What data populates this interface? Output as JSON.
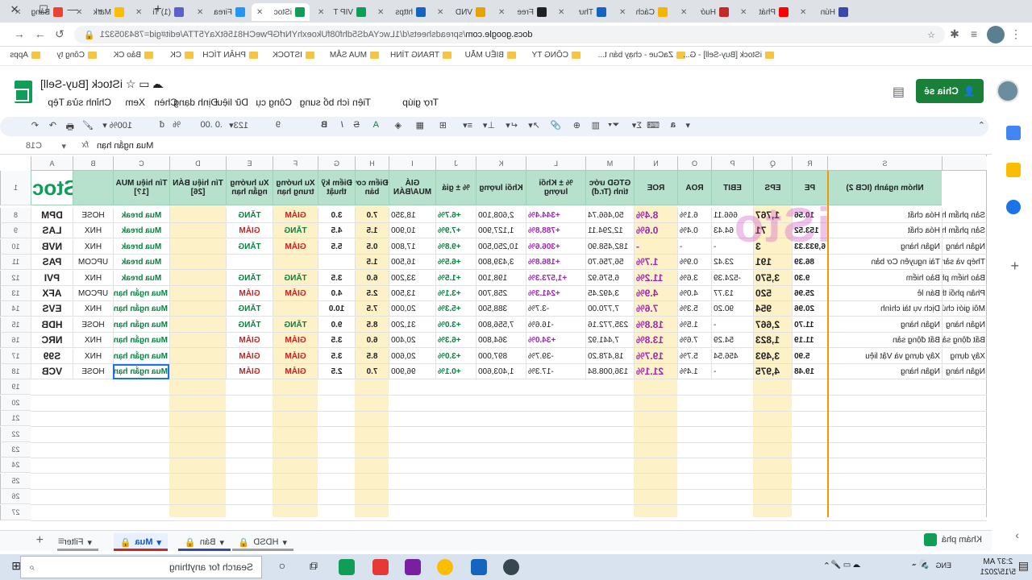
{
  "tabs": [
    {
      "title": "Bảng",
      "color": "#ea4335"
    },
    {
      "title": "Mark",
      "color": "#fbbc04"
    },
    {
      "title": "(1) Ti",
      "color": "#5b61c9"
    },
    {
      "title": "Firea",
      "color": "#2196f3"
    },
    {
      "title": "iStoc",
      "color": "#0f9d58",
      "active": true
    },
    {
      "title": "VIP T",
      "color": "#0f9d58"
    },
    {
      "title": "https",
      "color": "#1565c0"
    },
    {
      "title": "VND",
      "color": "#e6a400"
    },
    {
      "title": "Free",
      "color": "#202124"
    },
    {
      "title": "Thư",
      "color": "#1565c0"
    },
    {
      "title": "Cách",
      "color": "#f4b400"
    },
    {
      "title": "Huớ",
      "color": "#c62828"
    },
    {
      "title": "Phát",
      "color": "#ff0000"
    },
    {
      "title": "Hún",
      "color": "#3949ab"
    }
  ],
  "address": {
    "host": "docs.google.com",
    "path": "/spreadsheets/d/1LwcYAdS5dhf08fUkoexhYNrfGPweCH8156tXaY5TTA/edit#gid=784305321"
  },
  "bookmarks": [
    "Apps",
    "Công ty",
    "Bảo CK",
    "CK",
    "PHÂN TÍCH",
    "ISTOCK",
    "MUA SẮM",
    "TRANG TÌNH",
    "BIỂU MẪU",
    "CÔNG TY",
    "ZaCue - chạy bán t...",
    "iStock [Buy-Sell] - G..."
  ],
  "doc": {
    "title": "iStock [Buy-Sell]",
    "share": "Chia sẻ",
    "menus": [
      "Tệp",
      "Chỉnh sửa",
      "Xem",
      "Chèn",
      "Định dạng",
      "Dữ liệu",
      "Công cụ",
      "Tiện ích bổ sung",
      "Trợ giúp"
    ]
  },
  "toolbar": {
    "zoom": "100%",
    "currency": "đ",
    "percent": "%",
    "decimals": ".0  .00",
    "numfmt": "123",
    "fontsize": "9"
  },
  "formula": {
    "ref": "C18",
    "value": "Mua ngắn hạn"
  },
  "columns": [
    {
      "id": "A",
      "label": "A"
    },
    {
      "id": "B",
      "label": "B"
    },
    {
      "id": "C",
      "label": "C"
    },
    {
      "id": "D",
      "label": "D"
    },
    {
      "id": "E",
      "label": "E"
    },
    {
      "id": "F",
      "label": "F"
    },
    {
      "id": "G",
      "label": "G"
    },
    {
      "id": "H",
      "label": "H"
    },
    {
      "id": "I",
      "label": "I"
    },
    {
      "id": "J",
      "label": "J"
    },
    {
      "id": "K",
      "label": "K"
    },
    {
      "id": "L",
      "label": "L"
    },
    {
      "id": "M",
      "label": "M"
    },
    {
      "id": "N",
      "label": "N"
    },
    {
      "id": "O",
      "label": "O"
    },
    {
      "id": "P",
      "label": "P"
    },
    {
      "id": "Q",
      "label": "Q"
    },
    {
      "id": "R",
      "label": "R"
    },
    {
      "id": "S",
      "label": "S"
    }
  ],
  "headers": {
    "A": "iStock",
    "B": "",
    "C": "Tín hiệu MUA [1?]",
    "D": "Tín hiệu BÁN [26]",
    "E": "Xu hướng ngắn hạn",
    "F": "Xu hướng trung hạn",
    "G": "Điểm kỹ thuật",
    "H": "Điểm cơ bản",
    "I": "GIÁ MUA/BÁN",
    "J": "% ± giá",
    "K": "Khối lượng",
    "L": "% ± Khối lượng",
    "M": "GTGD ước tính (Tr.đ)",
    "N": "ROE",
    "O": "ROA",
    "P": "EBIT",
    "Q": "EPS",
    "R": "PE",
    "S": "Nhóm ngành (ICB 2)"
  },
  "rows": [
    {
      "n": "8",
      "A": "DPM",
      "B": "HOSE",
      "C": "Mua break",
      "E": "TĂNG",
      "F": "GIẢM",
      "G": "3.0",
      "H": "7.0",
      "I": "18,350",
      "J": "+6.7%",
      "K": "2,608,100",
      "L": "+344.4%",
      "M": "50,466.74",
      "N": "8.4%",
      "O": "6.1%",
      "P": "666.11",
      "Q": "1,767",
      "R": "10.56",
      "S": "Hóa chất",
      "S2": "Sản phẩm h"
    },
    {
      "n": "9",
      "A": "LAS",
      "B": "HNX",
      "C": "Mua break",
      "E": "GIẢM",
      "F": "TĂNG",
      "G": "4.5",
      "H": "1.5",
      "I": "10,900",
      "J": "+7.9%",
      "K": "1,127,900",
      "L": "+788.8%",
      "M": "12,294.11",
      "N": "0.6%",
      "O": "0.4%",
      "P": "64.43",
      "Q": "71",
      "R": "153.52",
      "S": "Hóa chất",
      "S2": "Sản phẩm h"
    },
    {
      "n": "10",
      "A": "NVB",
      "B": "HNX",
      "C": "Mua break",
      "E": "TĂNG",
      "F": "GIẢM",
      "G": "5.5",
      "H": "0.5",
      "I": "17,800",
      "J": "+9.8%",
      "K": "10,250,500",
      "L": "+306.6%",
      "M": "182,458.90",
      "N": "-",
      "O": "-",
      "P": "-",
      "Q": "3",
      "R": "6,933.33",
      "S": "Ngân hàng",
      "S2": "Ngân hàng"
    },
    {
      "n": "11",
      "A": "PAS",
      "B": "UPCOM",
      "C": "Mua break",
      "E": "",
      "F": "",
      "G": "",
      "H": "1.5",
      "I": "16,500",
      "J": "+6.5%",
      "K": "3,439,800",
      "L": "+186.8%",
      "M": "56,756.70",
      "N": "1.7%",
      "O": "0.9%",
      "P": "23.42",
      "Q": "191",
      "R": "86.39",
      "S": "Tài nguyên Cơ bản",
      "S2": "Thép và sản"
    },
    {
      "n": "12",
      "A": "PVI",
      "B": "HNX",
      "C": "Mua break",
      "E": "TĂNG",
      "F": "TĂNG",
      "G": "3.5",
      "H": "6.0",
      "I": "33,200",
      "J": "+1.5%",
      "K": "198,100",
      "L": "+1,573.3%",
      "M": "6,576.92",
      "N": "11.2%",
      "O": "3.6%",
      "P": "-524.39",
      "Q": "3,570",
      "R": "9.30",
      "S": "Bảo hiểm",
      "S2": "Bảo hiểm ph"
    },
    {
      "n": "13",
      "A": "AFX",
      "B": "UPCOM",
      "C": "Mua ngắn hạn",
      "E": "GIẢM",
      "F": "GIẢM",
      "G": "4.0",
      "H": "2.5",
      "I": "13,500",
      "J": "+3.1%",
      "K": "258,700",
      "L": "+241.3%",
      "M": "3,492.45",
      "N": "4.9%",
      "O": "4.0%",
      "P": "13.77",
      "Q": "520",
      "R": "25.96",
      "S": "Bán lẻ",
      "S2": "Phân phối th"
    },
    {
      "n": "14",
      "A": "EVS",
      "B": "HNX",
      "C": "Mua ngắn hạn",
      "E": "TĂNG",
      "F": "",
      "G": "10.0",
      "H": "7.5",
      "I": "20,000",
      "J": "+5.3%",
      "K": "388,500",
      "L": "-3.7%",
      "M": "7,770.00",
      "N": "7.6%",
      "O": "5.3%",
      "P": "90.20",
      "Q": "954",
      "R": "20.96",
      "S": "Dịch vụ tài chính",
      "S2": "Môi giới chứ"
    },
    {
      "n": "15",
      "A": "HDB",
      "B": "HOSE",
      "C": "Mua ngắn hạn",
      "E": "TĂNG",
      "F": "TĂNG",
      "G": "9.0",
      "H": "8.5",
      "I": "31,200",
      "J": "+3.0%",
      "K": "7,556,800",
      "L": "-16.6%",
      "M": "235,772.16",
      "N": "18.8%",
      "O": "1.5%",
      "P": "-",
      "Q": "2,667",
      "R": "11.70",
      "S": "Ngân hàng",
      "S2": "Ngân hàng"
    },
    {
      "n": "16",
      "A": "NRC",
      "B": "HNX",
      "C": "Mua ngắn hạn",
      "E": "GIẢM",
      "F": "GIẢM",
      "G": "3.5",
      "H": "6.0",
      "I": "20,400",
      "J": "+6.3%",
      "K": "364,800",
      "L": "+34.0%",
      "M": "7,441.92",
      "N": "13.8%",
      "O": "7.6%",
      "P": "54.29",
      "Q": "1,823",
      "R": "11.19",
      "S": "Bất động sản",
      "S2": "Bất động sả"
    },
    {
      "n": "17",
      "A": "S99",
      "B": "HNX",
      "C": "Mua ngắn hạn",
      "E": "GIẢM",
      "F": "GIẢM",
      "G": "3.5",
      "H": "8.5",
      "I": "20,600",
      "J": "+3.0%",
      "K": "897,000",
      "L": "-39.7%",
      "M": "18,478.20",
      "N": "19.7%",
      "O": "5.7%",
      "P": "456.54",
      "Q": "3,493",
      "R": "5.90",
      "S": "Xây dựng và Vật liệu",
      "S2": "Xây dựng"
    },
    {
      "n": "18",
      "A": "VCB",
      "B": "HOSE",
      "C": "Mua ngắn hạn",
      "E": "GIẢM",
      "F": "GIẢM",
      "G": "2.5",
      "H": "7.0",
      "I": "96,900",
      "J": "+0.1%",
      "K": "1,403,600",
      "L": "-17.3%",
      "M": "136,008.84",
      "N": "21.1%",
      "O": "1.4%",
      "P": "-",
      "Q": "4,975",
      "R": "19.48",
      "S": "Ngân hàng",
      "S2": "Ngân hàng"
    }
  ],
  "emptyRows": [
    "19",
    "20",
    "21",
    "22",
    "23",
    "24",
    "25",
    "26",
    "27"
  ],
  "sheets": [
    {
      "name": "HDSD"
    },
    {
      "name": "Bán"
    },
    {
      "name": "Mua",
      "active": true
    },
    {
      "name": "Filter"
    }
  ],
  "explore": "Khám phá",
  "taskbar": {
    "search": "Search for anything",
    "time": "2:37 AM",
    "date": "5/15/2021",
    "lang": "ENG"
  },
  "watermark": "iSto"
}
